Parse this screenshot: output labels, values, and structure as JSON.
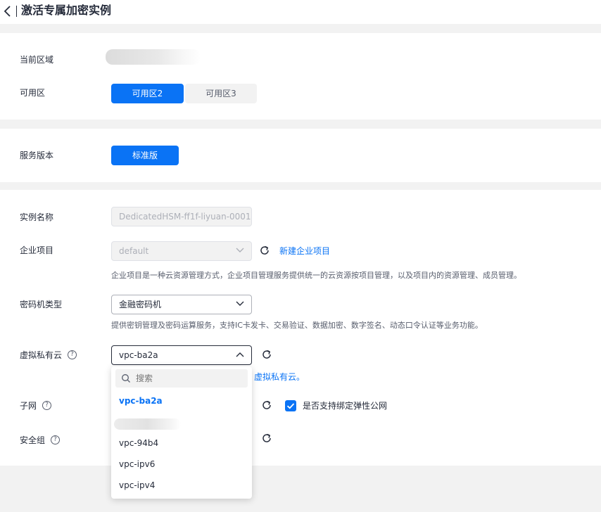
{
  "header": {
    "title": "激活专属加密实例"
  },
  "region": {
    "label": "当前区域"
  },
  "az": {
    "label": "可用区",
    "options": [
      "可用区2",
      "可用区3"
    ],
    "selected": "可用区2"
  },
  "version": {
    "label": "服务版本",
    "button": "标准版"
  },
  "instance_name": {
    "label": "实例名称",
    "value": "DedicatedHSM-ff1f-liyuan-0001"
  },
  "enterprise": {
    "label": "企业项目",
    "value": "default",
    "create_link": "新建企业项目",
    "hint": "企业项目是一种云资源管理方式，企业项目管理服务提供统一的云资源按项目管理，以及项目内的资源管理、成员管理。"
  },
  "hsm_type": {
    "label": "密码机类型",
    "value": "金融密码机",
    "hint": "提供密钥管理及密码运算服务，支持IC卡发卡、交易验证、数据加密、数字签名、动态口令认证等业务功能。"
  },
  "vpc": {
    "label": "虚拟私有云",
    "value": "vpc-ba2a",
    "link_tail": "虚拟私有云。",
    "dropdown": {
      "search_placeholder": "搜索",
      "items": [
        "vpc-ba2a",
        "vpc-94b4",
        "vpc-ipv6",
        "vpc-ipv4"
      ],
      "selected": "vpc-ba2a"
    }
  },
  "subnet": {
    "label": "子网",
    "checkbox_label": "是否支持绑定弹性公网",
    "checked": true
  },
  "security_group": {
    "label": "安全组"
  },
  "colors": {
    "primary": "#0a73f5",
    "text": "#252b3a",
    "page_bg": "#f2f2f2"
  },
  "icons": {
    "back": "chevron-left-icon",
    "refresh": "refresh-icon",
    "help": "help-circle-icon",
    "search": "search-icon",
    "check": "check-icon"
  }
}
